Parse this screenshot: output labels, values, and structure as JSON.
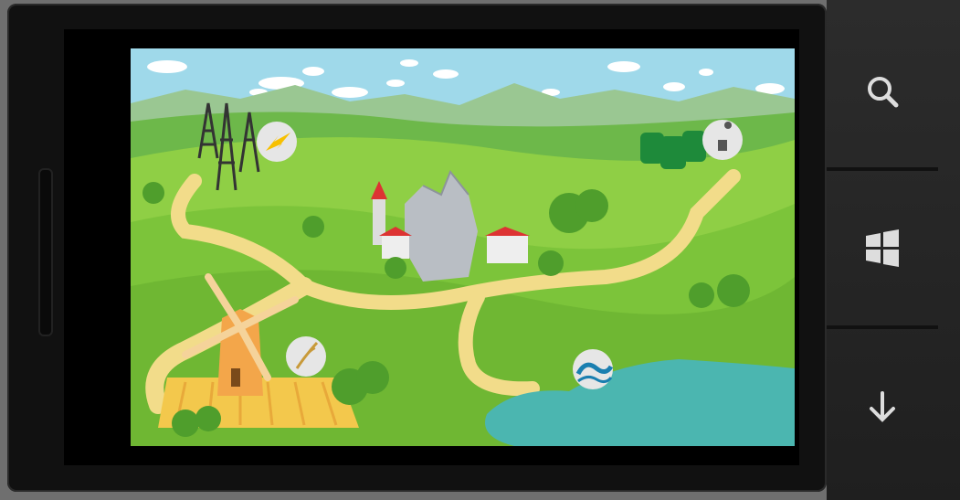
{
  "device": {
    "frame_color": "#111111",
    "nav_background": "#262626"
  },
  "nav_buttons": [
    {
      "icon": "search-icon"
    },
    {
      "icon": "windows-start-icon"
    },
    {
      "icon": "down-arrow-icon"
    }
  ],
  "game": {
    "sky_color": "#9fd9ea",
    "grass_color": "#7cc43a",
    "path_color": "#f2dc8a",
    "lake_color": "#4bb6b0",
    "map_points": [
      {
        "name": "power-station",
        "icon": "lightning-icon"
      },
      {
        "name": "recycling-center",
        "icon": "recycle-icon"
      },
      {
        "name": "city",
        "icon": "city-icon"
      },
      {
        "name": "windmill-farm",
        "icon": "wheat-icon"
      },
      {
        "name": "lake",
        "icon": "wave-icon"
      }
    ]
  }
}
